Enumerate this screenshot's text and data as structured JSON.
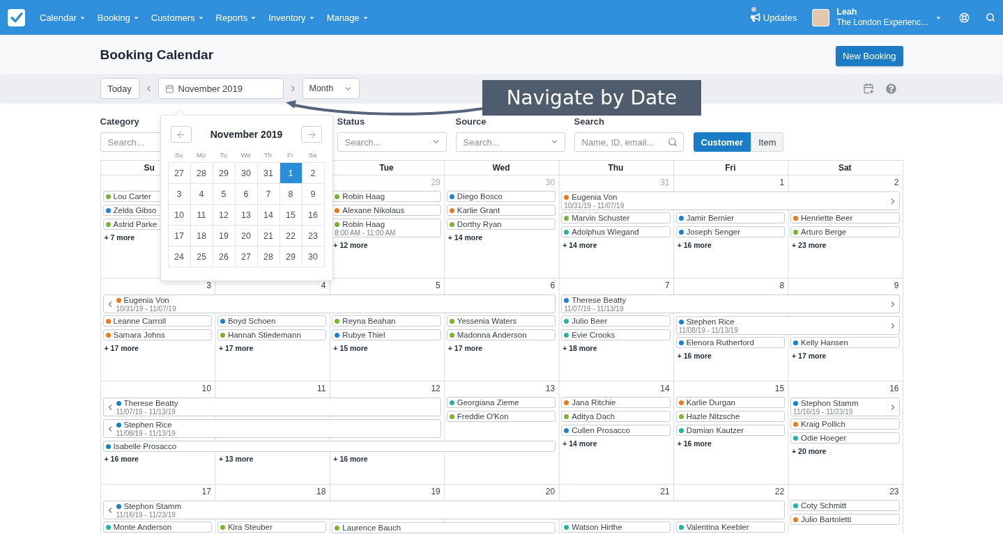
{
  "nav": {
    "menus": [
      "Calendar",
      "Booking",
      "Customers",
      "Reports",
      "Inventory",
      "Manage"
    ],
    "updates": "Updates",
    "user": {
      "name": "Leah",
      "org": "The London Experienc…"
    }
  },
  "header": {
    "title": "Booking Calendar",
    "button": "New Booking"
  },
  "toolbar": {
    "today": "Today",
    "date": "November 2019",
    "view": "Month"
  },
  "filters": [
    {
      "kind": "text",
      "label": "Category",
      "placeholder": "Search..."
    },
    {
      "kind": "select",
      "label": "Status",
      "placeholder": "Search..."
    },
    {
      "kind": "select",
      "label": "Source",
      "placeholder": "Search..."
    },
    {
      "kind": "search",
      "label": "Search",
      "placeholder": "Name, ID, email..."
    }
  ],
  "mode_toggle": [
    {
      "label": "Customer",
      "selected": true
    },
    {
      "label": "Item",
      "selected": false
    }
  ],
  "date_picker": {
    "title": "November 2019",
    "weekdays": [
      "Su",
      "Mo",
      "Tu",
      "We",
      "Th",
      "Fr",
      "Sa"
    ],
    "days": [
      {
        "label": "27",
        "selected": false
      },
      {
        "label": "28",
        "selected": false
      },
      {
        "label": "29",
        "selected": false
      },
      {
        "label": "30",
        "selected": false
      },
      {
        "label": "31",
        "selected": false
      },
      {
        "label": "1",
        "selected": true
      },
      {
        "label": "2",
        "selected": false
      },
      {
        "label": "3",
        "selected": false
      },
      {
        "label": "4",
        "selected": false
      },
      {
        "label": "5",
        "selected": false
      },
      {
        "label": "6",
        "selected": false
      },
      {
        "label": "7",
        "selected": false
      },
      {
        "label": "8",
        "selected": false
      },
      {
        "label": "9",
        "selected": false
      },
      {
        "label": "10",
        "selected": false
      },
      {
        "label": "11",
        "selected": false
      },
      {
        "label": "12",
        "selected": false
      },
      {
        "label": "13",
        "selected": false
      },
      {
        "label": "14",
        "selected": false
      },
      {
        "label": "15",
        "selected": false
      },
      {
        "label": "16",
        "selected": false
      },
      {
        "label": "17",
        "selected": false
      },
      {
        "label": "18",
        "selected": false
      },
      {
        "label": "19",
        "selected": false
      },
      {
        "label": "20",
        "selected": false
      },
      {
        "label": "21",
        "selected": false
      },
      {
        "label": "22",
        "selected": false
      },
      {
        "label": "23",
        "selected": false
      },
      {
        "label": "24",
        "selected": false
      },
      {
        "label": "25",
        "selected": false
      },
      {
        "label": "26",
        "selected": false
      },
      {
        "label": "27",
        "selected": false
      },
      {
        "label": "28",
        "selected": false
      },
      {
        "label": "29",
        "selected": false
      },
      {
        "label": "30",
        "selected": false
      }
    ]
  },
  "calendar": {
    "weekdays": [
      "Su",
      "Tue",
      "Wed",
      "Thu",
      "Fri",
      "Sat"
    ],
    "weeks": [
      {
        "days": [
          {
            "events": [
              {
                "name": "Lou Carter",
                "color": "#79b530"
              },
              {
                "name": "Zelda Gibso",
                "color": "#1a82cc"
              },
              {
                "name": "Astrid Parke",
                "color": "#79b530"
              }
            ],
            "more": "+ 7 more"
          },
          {
            "date": "29",
            "muted": true,
            "events": [
              {
                "name": "Robin Haag",
                "color": "#79b530"
              },
              {
                "name": "Alexane Nikolaus",
                "color": "#ec7a1c"
              },
              {
                "name": "Robin Haag",
                "time": "8:00 AM - 11:00 AM",
                "color": "#79b530"
              }
            ],
            "more": "+ 12 more"
          },
          {
            "date": "30",
            "muted": true,
            "events": [
              {
                "name": "Diego Bosco",
                "color": "#1a82cc"
              },
              {
                "name": "Karlie Grant",
                "color": "#ec7a1c"
              },
              {
                "name": "Dorthy Ryan",
                "color": "#79b530"
              }
            ],
            "more": "+ 14 more"
          },
          {
            "date": "31",
            "muted": true,
            "events": [
              {
                "name": "Marvin Schuster",
                "color": "#79b530"
              },
              {
                "name": "Adolphus Wiegand",
                "color": "#27b3a4"
              }
            ],
            "more": "+ 14 more"
          },
          {
            "date": "1",
            "muted": false,
            "events": [
              {
                "name": "Jamir Bernier",
                "color": "#1a82cc"
              },
              {
                "name": "Joseph Senger",
                "color": "#1a82cc"
              }
            ],
            "more": "+ 16 more"
          },
          {
            "date": "2",
            "muted": false,
            "events": [
              {
                "name": "Henriette Beer",
                "color": "#ec7a1c"
              },
              {
                "name": "Arturo Berge",
                "color": "#79b530"
              }
            ],
            "more": "+ 23 more"
          }
        ],
        "lanes": [
          [
            {
              "kind": "free"
            },
            {
              "kind": "free"
            },
            {
              "kind": "free"
            },
            {
              "kind": "free"
            },
            {
              "kind": "bar",
              "name": "Eugenia Von",
              "dates": "10/31/19 - 11/07/19",
              "color": "#ec7a1c",
              "continues_before": false,
              "continues_after": true
            },
            {
              "kind": "continued"
            },
            {
              "kind": "continued"
            }
          ]
        ]
      },
      {
        "days": [
          {
            "date": "3",
            "muted": false,
            "events": [
              {
                "name": "Leanne Carroll",
                "color": "#ec7a1c"
              },
              {
                "name": "Samara Johns",
                "color": "#ec7a1c"
              }
            ],
            "more": "+ 17 more"
          },
          {
            "date": "4",
            "muted": false,
            "events": [
              {
                "name": "Boyd Schoen",
                "color": "#1a82cc"
              },
              {
                "name": "Hannah Stiedemann",
                "color": "#79b530"
              }
            ],
            "more": "+ 17 more"
          },
          {
            "date": "5",
            "muted": false,
            "events": [
              {
                "name": "Reyna Beahan",
                "color": "#79b530"
              },
              {
                "name": "Rubye Thiel",
                "color": "#1a82cc"
              }
            ],
            "more": "+ 15 more"
          },
          {
            "date": "6",
            "muted": false,
            "events": [
              {
                "name": "Yessenia Waters",
                "color": "#79b530"
              },
              {
                "name": "Madonna Anderson",
                "color": "#79b530"
              }
            ],
            "more": "+ 17 more"
          },
          {
            "date": "7",
            "muted": false,
            "events": [
              {
                "name": "Julio Beer",
                "color": "#27b3a4"
              },
              {
                "name": "Evie Crooks",
                "color": "#27b3a4"
              }
            ],
            "more": "+ 18 more"
          },
          {
            "date": "8",
            "muted": false,
            "events": [
              {
                "name": "Elenora Rutherford",
                "color": "#1a82cc"
              }
            ],
            "more": "+ 16 more"
          },
          {
            "date": "9",
            "muted": false,
            "events": [
              {
                "name": "Kelly Hansen",
                "color": "#1a82cc"
              }
            ],
            "more": "+ 17 more"
          }
        ],
        "lanes": [
          [
            {
              "kind": "bar",
              "name": "Eugenia Von",
              "dates": "10/31/19 - 11/07/19",
              "color": "#ec7a1c",
              "continues_before": true,
              "continues_after": false
            },
            {
              "kind": "continued"
            },
            {
              "kind": "continued"
            },
            {
              "kind": "continued"
            },
            {
              "kind": "bar",
              "name": "Therese Beatty",
              "dates": "11/07/19 - 11/13/19",
              "color": "#1a82cc",
              "continues_before": false,
              "continues_after": true
            },
            {
              "kind": "continued"
            },
            {
              "kind": "continued"
            }
          ],
          [
            {
              "kind": "free"
            },
            {
              "kind": "free"
            },
            {
              "kind": "free"
            },
            {
              "kind": "free"
            },
            {
              "kind": "free"
            },
            {
              "kind": "bar",
              "name": "Stephen Rice",
              "dates": "11/08/19 - 11/13/19",
              "color": "#1a82cc",
              "continues_before": false,
              "continues_after": true
            },
            {
              "kind": "continued"
            }
          ]
        ]
      },
      {
        "days": [
          {
            "date": "10",
            "muted": false,
            "more": "+ 16 more"
          },
          {
            "date": "11",
            "muted": false,
            "more": "+ 13 more"
          },
          {
            "date": "12",
            "muted": false,
            "more": "+ 16 more"
          },
          {
            "date": "13",
            "muted": false,
            "events": [
              {
                "name": "Georgiana Zieme",
                "color": "#27b3a4"
              },
              {
                "name": "Freddie O'Kon",
                "color": "#79b530"
              }
            ]
          },
          {
            "date": "14",
            "muted": false,
            "events": [
              {
                "name": "Jana Ritchie",
                "color": "#ec7a1c"
              },
              {
                "name": "Aditya Dach",
                "color": "#79b530"
              },
              {
                "name": "Cullen Prosacco",
                "color": "#1a82cc"
              }
            ],
            "more": "+ 14 more"
          },
          {
            "date": "15",
            "muted": false,
            "events": [
              {
                "name": "Karlie Durgan",
                "color": "#ec7a1c"
              },
              {
                "name": "Hazle Nitzsche",
                "color": "#79b530"
              },
              {
                "name": "Damian Kautzer",
                "color": "#27b3a4"
              }
            ],
            "more": "+ 16 more"
          },
          {
            "date": "16",
            "muted": false,
            "events": [
              {
                "name": "Kraig Pollich",
                "color": "#ec7a1c"
              },
              {
                "name": "Odie Hoeger",
                "color": "#27b3a4"
              }
            ],
            "more": "+ 20 more"
          }
        ],
        "lanes": [
          [
            {
              "kind": "bar",
              "name": "Therese Beatty",
              "dates": "11/07/19 - 11/13/19",
              "color": "#1a82cc",
              "continues_before": true,
              "continues_after": false
            },
            {
              "kind": "continued"
            },
            {
              "kind": "continued"
            },
            {
              "kind": "free"
            },
            {
              "kind": "free"
            },
            {
              "kind": "free"
            },
            {
              "kind": "bar",
              "name": "Stephon Stamm",
              "dates": "11/16/19 - 11/23/19",
              "color": "#1a82cc",
              "continues_before": false,
              "continues_after": true
            }
          ],
          [
            {
              "kind": "bar",
              "name": "Stephen Rice",
              "dates": "11/08/19 - 11/13/19",
              "color": "#1a82cc",
              "continues_before": true,
              "continues_after": false
            },
            {
              "kind": "continued"
            },
            {
              "kind": "continued"
            },
            {
              "kind": "free"
            },
            {
              "kind": "free"
            },
            {
              "kind": "free"
            },
            {
              "kind": "free"
            }
          ],
          [
            {
              "kind": "bar",
              "name": "Isabelle Prosacco",
              "color": "#1a82cc",
              "continues_before": false,
              "continues_after": false
            },
            {
              "kind": "continued"
            },
            {
              "kind": "continued"
            },
            {
              "kind": "continued"
            },
            {
              "kind": "free"
            },
            {
              "kind": "free"
            },
            {
              "kind": "free"
            }
          ]
        ]
      },
      {
        "days": [
          {
            "date": "17",
            "muted": false,
            "events": [
              {
                "name": "Monte Anderson",
                "color": "#27b3a4"
              }
            ]
          },
          {
            "date": "18",
            "muted": false,
            "events": [
              {
                "name": "Kira Steuber",
                "color": "#79b530"
              }
            ]
          },
          {
            "date": "19",
            "muted": false
          },
          {
            "date": "20",
            "muted": false
          },
          {
            "date": "21",
            "muted": false,
            "events": [
              {
                "name": "Watson Hirthe",
                "color": "#27b3a4"
              }
            ]
          },
          {
            "date": "22",
            "muted": false,
            "events": [
              {
                "name": "Valentina Keebler",
                "color": "#27b3a4"
              }
            ]
          },
          {
            "date": "23",
            "muted": false,
            "events": [
              {
                "name": "Coty Schmitt",
                "color": "#27b3a4"
              },
              {
                "name": "Julio Bartoletti",
                "color": "#ec7a1c"
              }
            ]
          }
        ],
        "lanes": [
          [
            {
              "kind": "bar",
              "name": "Stephon Stamm",
              "dates": "11/16/19 - 11/23/19",
              "color": "#1a82cc",
              "continues_before": true,
              "continues_after": false
            },
            {
              "kind": "continued"
            },
            {
              "kind": "continued"
            },
            {
              "kind": "continued"
            },
            {
              "kind": "continued"
            },
            {
              "kind": "continued"
            },
            {
              "kind": "free"
            }
          ],
          [
            {
              "kind": "free"
            },
            {
              "kind": "free"
            },
            {
              "kind": "bar",
              "name": "Laurence Bauch",
              "color": "#79b530",
              "continues_before": false,
              "continues_after": false
            },
            {
              "kind": "continued"
            },
            {
              "kind": "free"
            },
            {
              "kind": "free"
            },
            {
              "kind": "free"
            }
          ]
        ]
      }
    ]
  },
  "annotation": {
    "text": "Navigate by Date"
  }
}
